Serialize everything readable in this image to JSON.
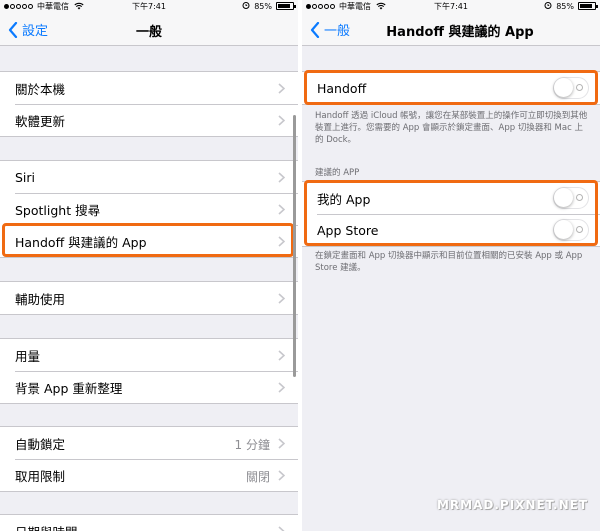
{
  "left_screen": {
    "status": {
      "carrier": "中華電信",
      "time": "下午7:41",
      "battery": "85%"
    },
    "nav": {
      "back_label": "設定",
      "title": "一般"
    },
    "groups": [
      {
        "rows": [
          {
            "label": "關於本機"
          },
          {
            "label": "軟體更新"
          }
        ]
      },
      {
        "rows": [
          {
            "label": "Siri"
          },
          {
            "label": "Spotlight 搜尋"
          },
          {
            "label": "Handoff 與建議的 App"
          }
        ]
      },
      {
        "rows": [
          {
            "label": "輔助使用"
          }
        ]
      },
      {
        "rows": [
          {
            "label": "用量"
          },
          {
            "label": "背景 App 重新整理"
          }
        ]
      },
      {
        "rows": [
          {
            "label": "自動鎖定",
            "detail": "1 分鐘"
          },
          {
            "label": "取用限制",
            "detail": "關閉"
          }
        ]
      },
      {
        "rows": [
          {
            "label": "日期與時間"
          }
        ]
      }
    ]
  },
  "right_screen": {
    "status": {
      "carrier": "中華電信",
      "time": "下午7:41",
      "battery": "85%"
    },
    "nav": {
      "back_label": "一般",
      "title": "Handoff 與建議的 App"
    },
    "handoff": {
      "label": "Handoff",
      "enabled": false
    },
    "handoff_footer": "Handoff 透過 iCloud 帳號，讓您在某部裝置上的操作可立即切換到其他裝置上進行。您需要的 App 會顯示於鎖定畫面、App 切換器和 Mac 上的 Dock。",
    "suggested_header": "建議的 APP",
    "suggested": [
      {
        "label": "我的 App",
        "enabled": false
      },
      {
        "label": "App Store",
        "enabled": false
      }
    ],
    "suggested_footer": "在鎖定畫面和 App 切換器中顯示和目前位置相關的已安裝 App 或 App Store 建議。"
  },
  "watermark": "MRMAD.PIXNET.NET",
  "colors": {
    "accent": "#0a7aff",
    "highlight": "#f06a12",
    "background": "#efeff4"
  }
}
